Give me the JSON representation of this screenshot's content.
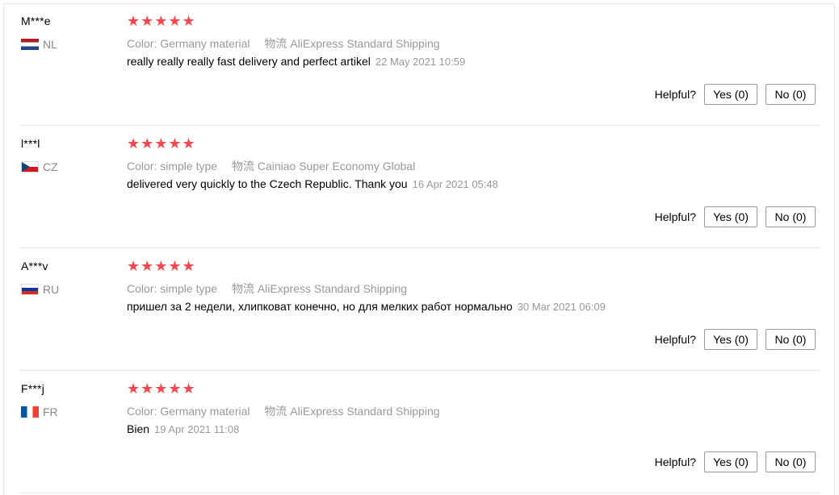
{
  "reviews": [
    {
      "user": "M***e",
      "country": "NL",
      "stars": "★★★★★",
      "sku_label": "Color:",
      "sku_value": "Germany material",
      "shipping_label": "物流",
      "shipping_value": "AliExpress Standard Shipping",
      "text": "really really really fast delivery and perfect artikel",
      "date": "22 May 2021 10:59",
      "helpful_label": "Helpful?",
      "yes_label": "Yes (0)",
      "no_label": "No (0)"
    },
    {
      "user": "l***l",
      "country": "CZ",
      "stars": "★★★★★",
      "sku_label": "Color:",
      "sku_value": "simple type",
      "shipping_label": "物流",
      "shipping_value": "Cainiao Super Economy Global",
      "text": "delivered very quickly to the Czech Republic. Thank you",
      "date": "16 Apr 2021 05:48",
      "helpful_label": "Helpful?",
      "yes_label": "Yes (0)",
      "no_label": "No (0)"
    },
    {
      "user": "A***v",
      "country": "RU",
      "stars": "★★★★★",
      "sku_label": "Color:",
      "sku_value": "simple type",
      "shipping_label": "物流",
      "shipping_value": "AliExpress Standard Shipping",
      "text": "пришел за 2 недели, хлипковат конечно, но для мелких работ нормально",
      "date": "30 Mar 2021 06:09",
      "helpful_label": "Helpful?",
      "yes_label": "Yes (0)",
      "no_label": "No (0)"
    },
    {
      "user": "F***j",
      "country": "FR",
      "stars": "★★★★★",
      "sku_label": "Color:",
      "sku_value": "Germany material",
      "shipping_label": "物流",
      "shipping_value": "AliExpress Standard Shipping",
      "text": "Bien",
      "date": "19 Apr 2021 11:08",
      "helpful_label": "Helpful?",
      "yes_label": "Yes (0)",
      "no_label": "No (0)"
    }
  ],
  "colors": {
    "star": "#f2494d",
    "muted_text": "#999999",
    "divider": "#e8e8e8"
  },
  "icons": {
    "star": "star-icon",
    "flag": "flag-icon"
  }
}
